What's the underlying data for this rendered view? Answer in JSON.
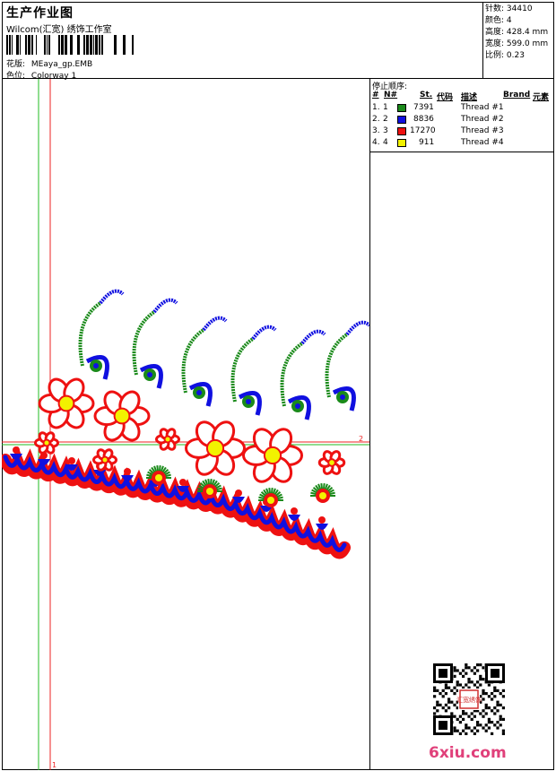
{
  "header": {
    "title": "生产作业图",
    "company": "Wilcom(汇宽) 绣饰工作室",
    "design_label": "花版:",
    "design_value": "MEaya_gp.EMB",
    "colorway_label": "色位:",
    "colorway_value": "Colorway 1"
  },
  "stats": {
    "stitches_label": "针数:",
    "stitches_value": "34410",
    "colors_label": "颜色:",
    "colors_value": "4",
    "height_label": "高度:",
    "height_value": "428.4 mm",
    "width_label": "宽度:",
    "width_value": "599.0 mm",
    "scale_label": "比例:",
    "scale_value": "0.23"
  },
  "thread_table": {
    "title": "停止顺序:",
    "col_hash": "#",
    "col_n": "N#",
    "col_st": "St.",
    "col_code": "代码",
    "col_desc": "描述",
    "col_brand": "Brand",
    "col_elem": "元素",
    "rows": [
      {
        "idx": "1.",
        "n": "1",
        "color": "#1a8a1a",
        "stitches": "7391",
        "desc": "Thread #1"
      },
      {
        "idx": "2.",
        "n": "2",
        "color": "#1010e0",
        "stitches": "8836",
        "desc": "Thread #2"
      },
      {
        "idx": "3.",
        "n": "3",
        "color": "#ee1111",
        "stitches": "17270",
        "desc": "Thread #3"
      },
      {
        "idx": "4.",
        "n": "4",
        "color": "#f2f200",
        "stitches": "911",
        "desc": "Thread #4"
      }
    ]
  },
  "canvas": {
    "marker_right": "2",
    "marker_bottom": "1"
  },
  "watermark": "6xiu.com",
  "qr_seal": "汇宽绣饰"
}
